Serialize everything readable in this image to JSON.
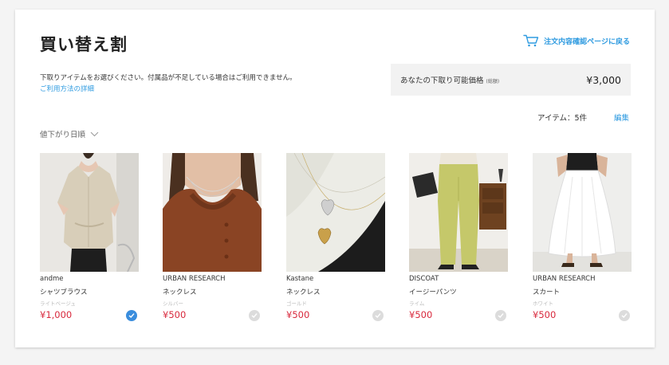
{
  "header": {
    "title": "買い替え割",
    "back_link": "注文内容確認ページに戻る",
    "cart_icon": "cart-icon"
  },
  "notice": {
    "description": "下取りアイテムをお選びください。付属品が不足している場合はご利用できません。",
    "help_link": "ご利用方法の詳細"
  },
  "tradein": {
    "label": "あなたの下取り可能価格",
    "label_note": "(総額)",
    "value": "¥3,000"
  },
  "items_bar": {
    "count": "アイテム：5件",
    "edit": "編集"
  },
  "sort": {
    "label": "値下がり日順",
    "icon": "chevron-down-icon"
  },
  "products": [
    {
      "brand": "andme",
      "type": "シャツブラウス",
      "color": "ライトベージュ",
      "price": "¥1,000",
      "selected": true
    },
    {
      "brand": "URBAN RESEARCH",
      "type": "ネックレス",
      "color": "シルバー",
      "price": "¥500",
      "selected": false
    },
    {
      "brand": "Kastane",
      "type": "ネックレス",
      "color": "ゴールド",
      "price": "¥500",
      "selected": false
    },
    {
      "brand": "DISCOAT",
      "type": "イージーパンツ",
      "color": "ライム",
      "price": "¥500",
      "selected": false
    },
    {
      "brand": "URBAN RESEARCH",
      "type": "スカート",
      "color": "ホワイト",
      "price": "¥500",
      "selected": false
    }
  ],
  "colors": {
    "accent": "#2f9be0",
    "price": "#d8283c",
    "check_on": "#3a8ddd",
    "check_off": "#dcdcdc"
  }
}
